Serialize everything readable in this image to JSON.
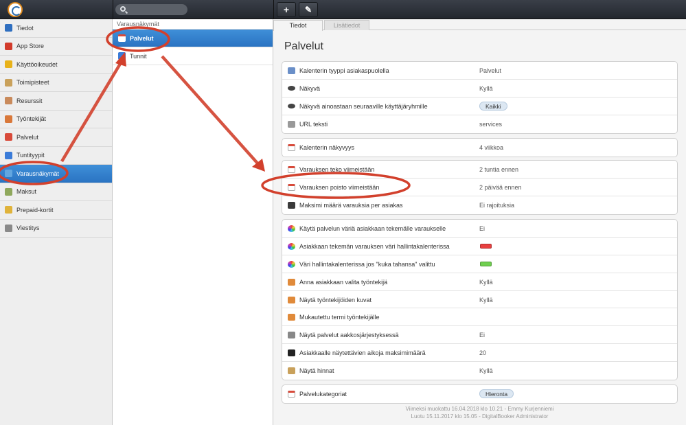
{
  "sidebar": {
    "items": [
      {
        "label": "Tiedot",
        "icon": "info-icon",
        "color": "#2f6fc0"
      },
      {
        "label": "App Store",
        "icon": "app-store-icon",
        "color": "#d23b2b"
      },
      {
        "label": "Käyttöoikeudet",
        "icon": "star-icon",
        "color": "#e8b21a"
      },
      {
        "label": "Toimipisteet",
        "icon": "building-icon",
        "color": "#c9a15b"
      },
      {
        "label": "Resurssit",
        "icon": "house-icon",
        "color": "#c98a5b"
      },
      {
        "label": "Työntekijät",
        "icon": "person-icon",
        "color": "#d9783a"
      },
      {
        "label": "Palvelut",
        "icon": "calendar-icon",
        "color": "#d84a3a"
      },
      {
        "label": "Tuntityypit",
        "icon": "calendar-blue-icon",
        "color": "#3a7bd8"
      },
      {
        "label": "Varausnäkymät",
        "icon": "globe-icon",
        "color": "#62a6e0"
      },
      {
        "label": "Maksut",
        "icon": "cash-icon",
        "color": "#8fa85c"
      },
      {
        "label": "Prepaid-kortit",
        "icon": "card-icon",
        "color": "#e0b33a"
      },
      {
        "label": "Viestitys",
        "icon": "envelope-icon",
        "color": "#8a8a8a"
      }
    ],
    "active_index": 8
  },
  "middle": {
    "header": "Varausnäkymät",
    "items": [
      {
        "label": "Palvelut",
        "icon": "calendar-icon"
      },
      {
        "label": "Tunnit",
        "icon": "calendar-blue-icon"
      }
    ]
  },
  "tabs": [
    {
      "label": "Tiedot"
    },
    {
      "label": "Lisätiedot"
    }
  ],
  "page_title": "Palvelut",
  "groups": [
    {
      "rows": [
        {
          "label": "Kalenterin tyyppi asiakaspuolella",
          "value": "Palvelut",
          "icon": "window-icon"
        },
        {
          "label": "Näkyvä",
          "value": "Kyllä",
          "icon": "eye-icon"
        },
        {
          "label": "Näkyvä ainoastaan seuraaville käyttäjäryhmille",
          "pill": "Kaikki",
          "icon": "eye-icon"
        },
        {
          "label": "URL teksti",
          "value": "services",
          "icon": "url-icon"
        }
      ]
    },
    {
      "rows": [
        {
          "label": "Kalenterin näkyvyys",
          "value": "4 viikkoa",
          "icon": "calendar-icon"
        }
      ]
    },
    {
      "rows": [
        {
          "label": "Varauksen teko viimeistään",
          "value": "2 tuntia ennen",
          "icon": "calendar-icon"
        },
        {
          "label": "Varauksen poisto viimeistään",
          "value": "2 päivää ennen",
          "icon": "calendar-icon"
        },
        {
          "label": "Maksimi määrä varauksia per asiakas",
          "value": "Ei rajoituksia",
          "icon": "traffic-light-icon"
        }
      ]
    },
    {
      "rows": [
        {
          "label": "Käytä palvelun väriä asiakkaan tekemälle varaukselle",
          "value": "Ei",
          "icon": "color-wheel-icon"
        },
        {
          "label": "Asiakkaan tekemän varauksen väri hallintakalenterissa",
          "swatch": "#e84040",
          "icon": "color-wheel-icon"
        },
        {
          "label": "Väri hallintakalenterissa jos \"kuka tahansa\" valittu",
          "swatch": "#6fcf4f",
          "icon": "color-wheel-icon"
        },
        {
          "label": "Anna asiakkaan valita työntekijä",
          "value": "Kyllä",
          "icon": "person-icon"
        },
        {
          "label": "Näytä työntekijöiden kuvat",
          "value": "Kyllä",
          "icon": "person-icon"
        },
        {
          "label": "Mukautettu termi työntekijälle",
          "value": "",
          "icon": "person-icon"
        },
        {
          "label": "Näytä palvelut aakkosjärjestyksessä",
          "value": "Ei",
          "icon": "sort-icon"
        },
        {
          "label": "Asiakkaalle näytettävien aikoja maksimimäärä",
          "value": "20",
          "icon": "counter-icon"
        },
        {
          "label": "Näytä hinnat",
          "value": "Kyllä",
          "icon": "price-tag-icon"
        }
      ]
    },
    {
      "rows": [
        {
          "label": "Palvelukategoriat",
          "pill": "Hieronta",
          "icon": "calendar-icon"
        }
      ]
    }
  ],
  "footer": {
    "modified": "Viimeksi muokattu 16.04.2018 klo 10.21 - Emmy Kurjenniemi",
    "created": "Luotu 15.11.2017 klo 15.05 - DigitalBooker Administrator"
  },
  "toolbar": {
    "add_label": "+",
    "edit_label": "✎"
  },
  "annotation_color": "#d2402c"
}
